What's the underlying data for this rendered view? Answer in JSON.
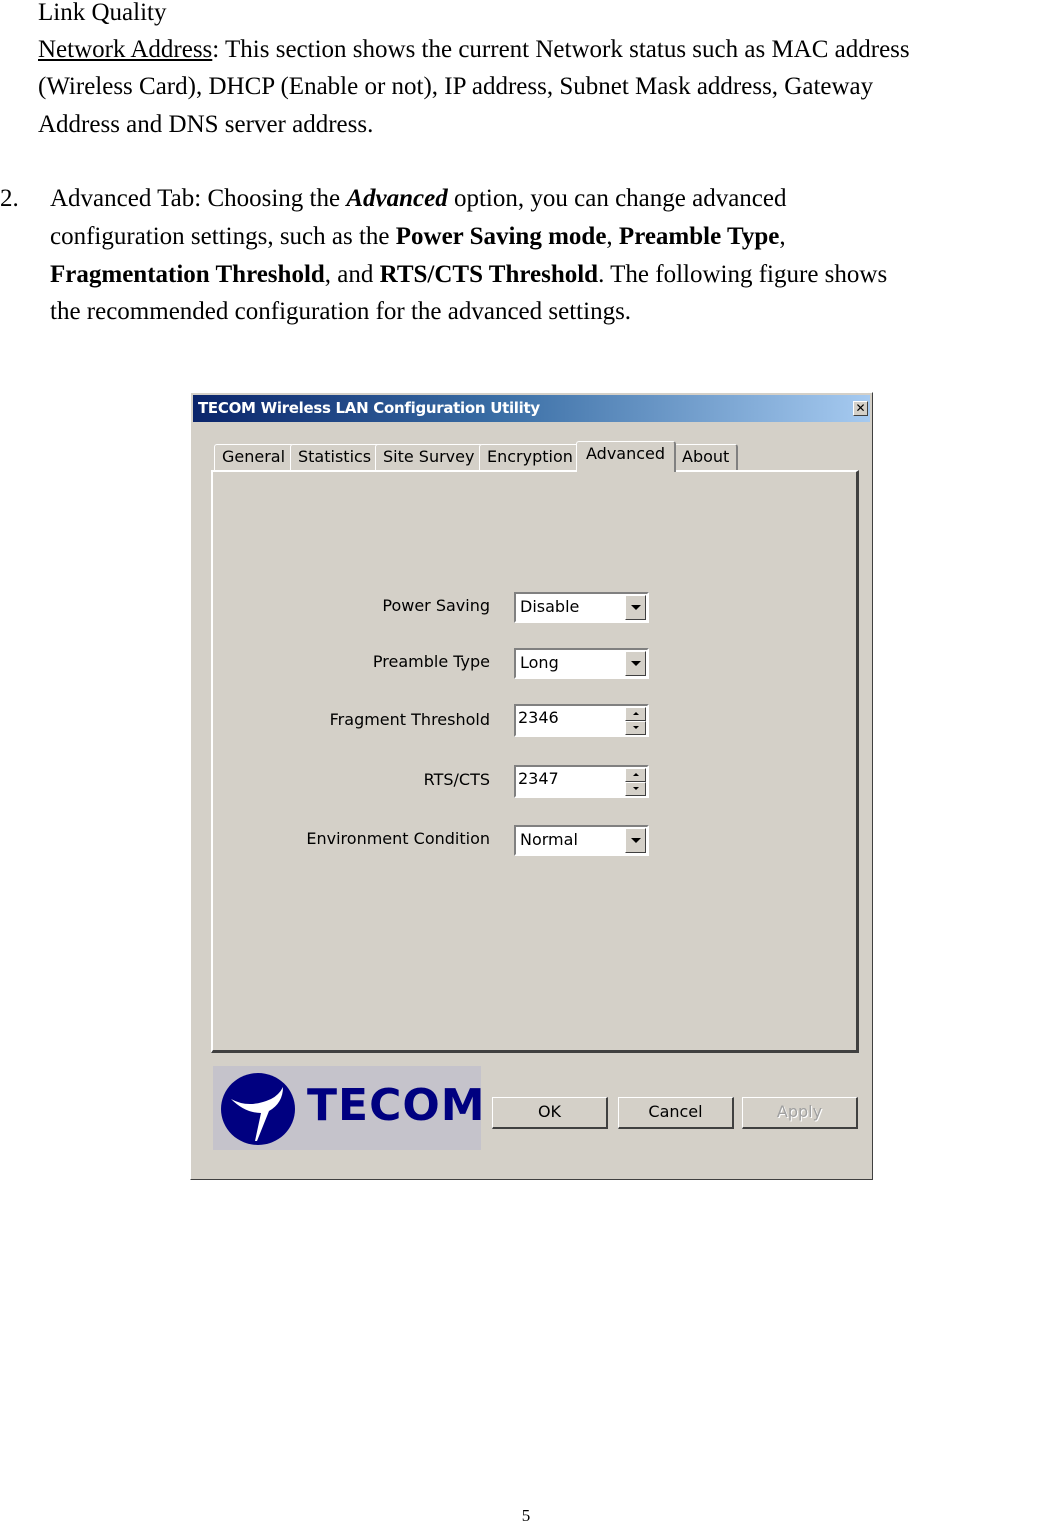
{
  "document": {
    "link_quality_label": "Link Quality",
    "network_address": {
      "term": "Network Address",
      "line1_rest": ": This section shows the current Network status such as MAC address",
      "line2": "(Wireless Card), DHCP (Enable or not), IP address, Subnet Mask address, Gateway",
      "line3": "Address and DNS server address."
    },
    "item2": {
      "number": "2.",
      "l1_a": "Advanced Tab: Choosing the ",
      "l1_b": "Advanced",
      "l1_c": " option, you can change advanced",
      "l2_a": "configuration settings, such as the ",
      "l2_b": "Power Saving mode",
      "l2_c": ", ",
      "l2_d": "Preamble Type",
      "l2_e": ",",
      "l3_a": "Fragmentation Threshold",
      "l3_b": ", and ",
      "l3_c": "RTS/CTS Threshold",
      "l3_d": ". The following figure shows",
      "l4": "the recommended configuration for the advanced settings."
    },
    "page_number": "5"
  },
  "dialog": {
    "title": "TECOM Wireless LAN Configuration Utility",
    "close_glyph": "✕",
    "tabs": [
      {
        "label": "General",
        "active": false
      },
      {
        "label": "Statistics",
        "active": false
      },
      {
        "label": "Site Survey",
        "active": false
      },
      {
        "label": "Encryption",
        "active": false
      },
      {
        "label": "Advanced",
        "active": true
      },
      {
        "label": "About",
        "active": false
      }
    ],
    "fields": {
      "power_saving": {
        "label": "Power Saving",
        "value": "Disable"
      },
      "preamble_type": {
        "label": "Preamble Type",
        "value": "Long"
      },
      "fragment_threshold": {
        "label": "Fragment Threshold",
        "value": "2346"
      },
      "rts_cts": {
        "label": "RTS/CTS",
        "value": "2347"
      },
      "environment_condition": {
        "label": "Environment Condition",
        "value": "Normal"
      }
    },
    "logo_text": "TECOM",
    "buttons": {
      "ok": "OK",
      "cancel": "Cancel",
      "apply": "Apply"
    },
    "colors": {
      "title_gradient_start": "#0a246a",
      "title_gradient_end": "#a6caf0",
      "face": "#d4d0c8",
      "logo_blue": "#000080"
    }
  }
}
